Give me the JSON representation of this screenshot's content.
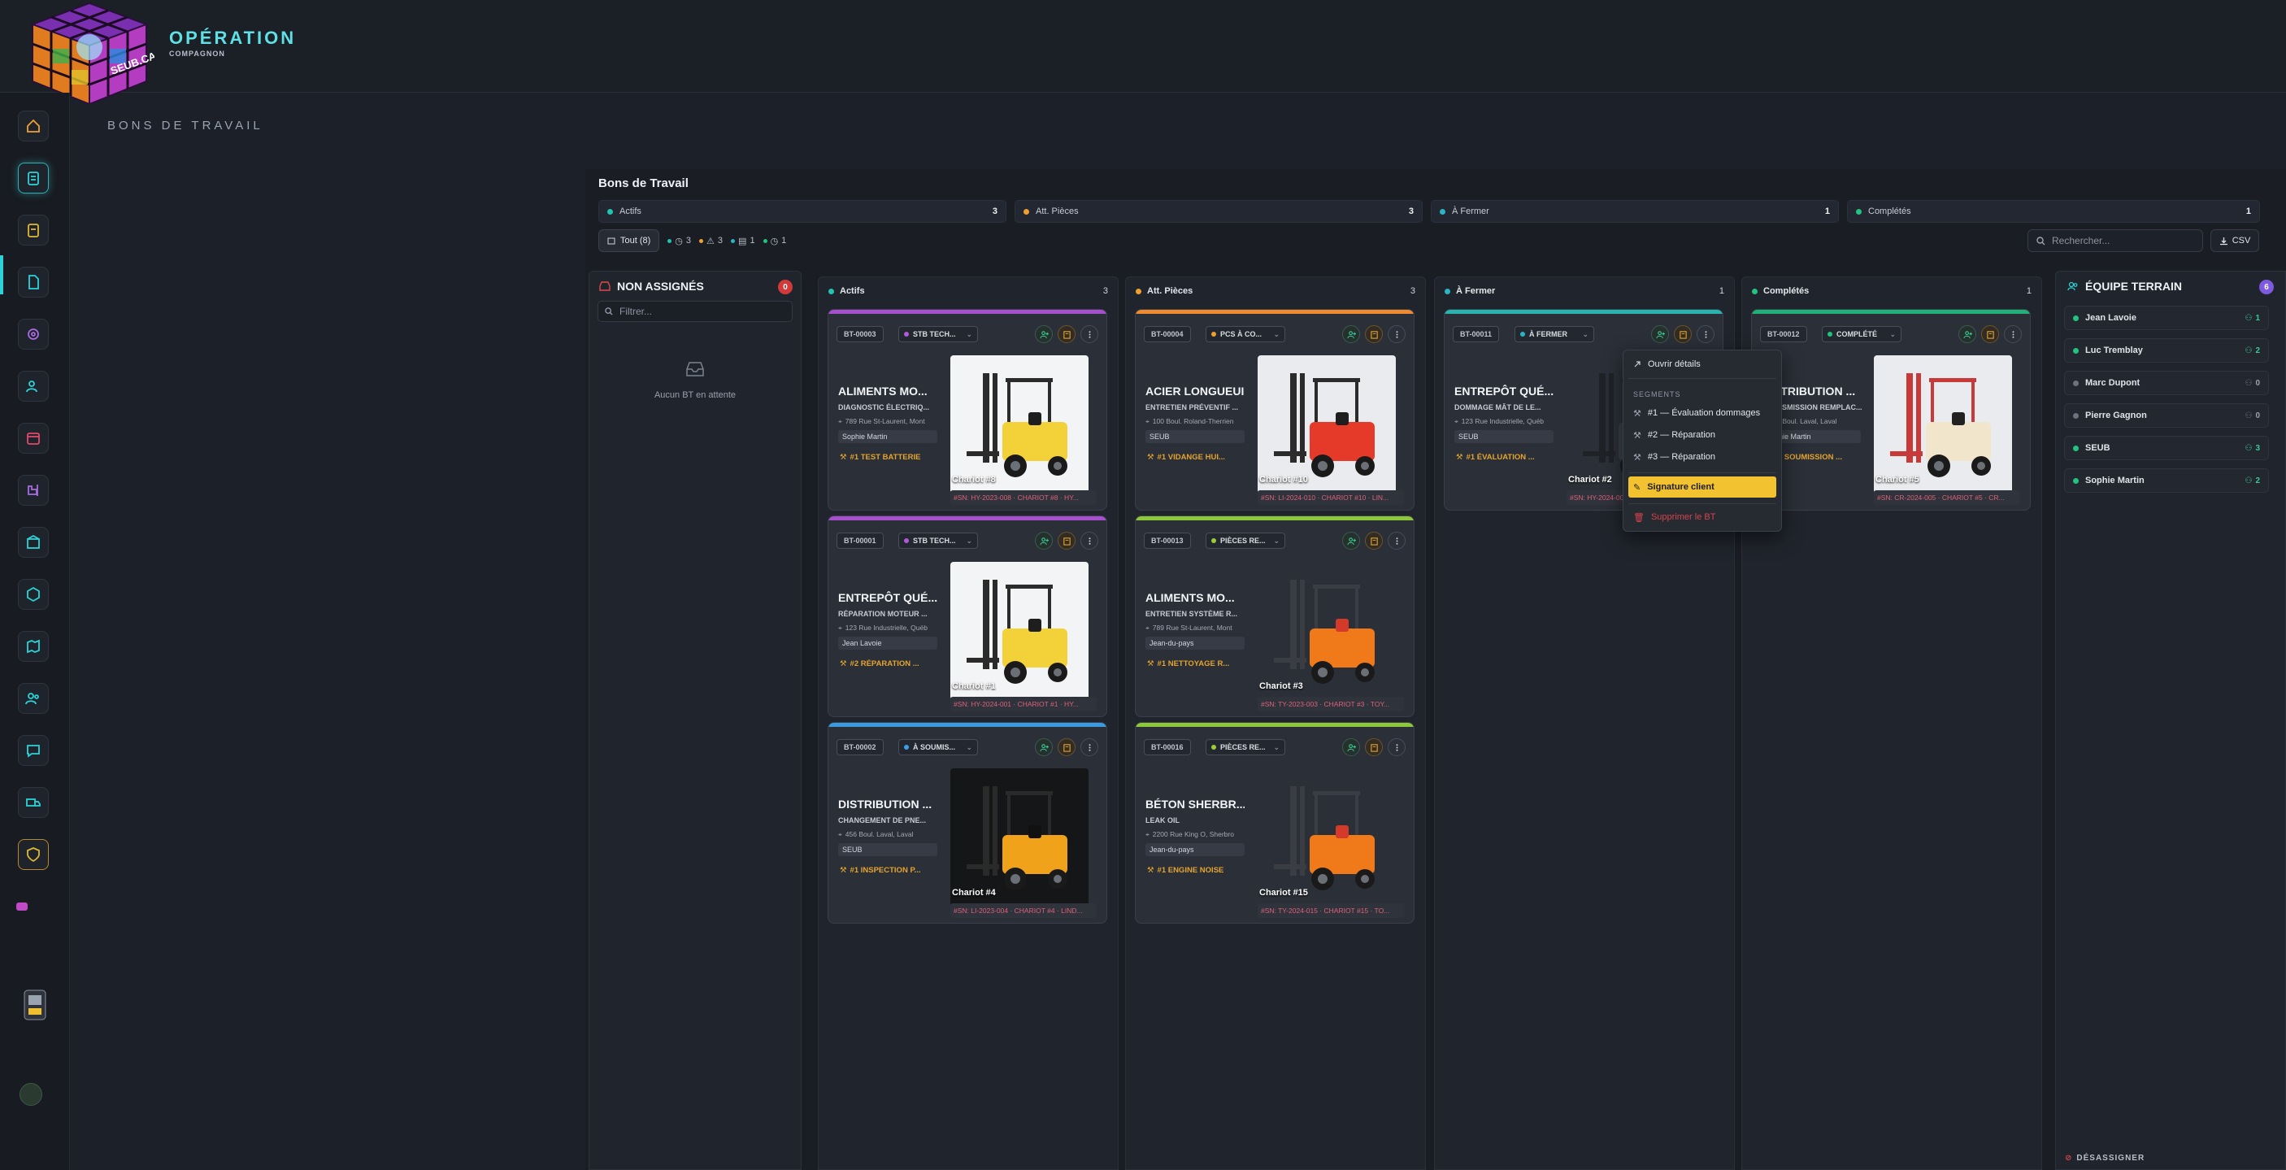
{
  "app": {
    "brand_title": "OPÉRATION",
    "brand_sub": "COMPAGNON",
    "logo_text": "SEUB.CA",
    "page_title": "BONS DE TRAVAIL"
  },
  "board": {
    "title": "Bons de Travail",
    "stats": [
      {
        "label": "Actifs",
        "count": "3",
        "color": "#22c3b0"
      },
      {
        "label": "Att. Pièces",
        "count": "3",
        "color": "#f0a030"
      },
      {
        "label": "À Fermer",
        "count": "1",
        "color": "#2ab4c4"
      },
      {
        "label": "Complétés",
        "count": "1",
        "color": "#22c380"
      }
    ],
    "filters": {
      "all_label": "Tout (8)",
      "chips": [
        "3",
        "3",
        "1",
        "1"
      ]
    },
    "search_placeholder": "Rechercher...",
    "csv_label": "CSV"
  },
  "unassigned": {
    "title": "NON ASSIGNÉS",
    "count": "0",
    "filter_placeholder": "Filtrer...",
    "empty_text": "Aucun BT en attente"
  },
  "columns": [
    {
      "title": "Actifs",
      "count": "3",
      "color": "#22c3b0"
    },
    {
      "title": "Att. Pièces",
      "count": "3",
      "color": "#f0a030"
    },
    {
      "title": "À Fermer",
      "count": "1",
      "color": "#2ab4c4"
    },
    {
      "title": "Complétés",
      "count": "1",
      "color": "#22c380"
    }
  ],
  "cards": [
    {
      "bt": "BT-00003",
      "status": "STB TECH...",
      "status_color": "#b05bd6",
      "top": "#a84fd0",
      "client": "ALIMENTS MO...",
      "job": "DIAGNOSTIC ÉLECTRIQ...",
      "address": "789 Rue St-Laurent, Mont",
      "tech": "Sophie Martin",
      "segment": "#1 TEST BATTERIE",
      "chariot": "Chariot #8",
      "sn": "#SN: HY-2023-008 · CHARIOT #8 · HY...",
      "photo": "yellow"
    },
    {
      "bt": "BT-00001",
      "status": "STB TECH...",
      "status_color": "#b05bd6",
      "top": "#a84fd0",
      "client": "ENTREPÔT QUÉ...",
      "job": "RÉPARATION MOTEUR ...",
      "address": "123 Rue Industrielle, Québ",
      "tech": "Jean Lavoie",
      "segment": "#2 RÉPARATION ...",
      "chariot": "Chariot #1",
      "sn": "#SN: HY-2024-001 · CHARIOT #1 · HY...",
      "photo": "yellow"
    },
    {
      "bt": "BT-00002",
      "status": "À SOUMIS...",
      "status_color": "#3aa0e0",
      "top": "#3a9be0",
      "client": "DISTRIBUTION ...",
      "job": "CHANGEMENT DE PNE...",
      "address": "456 Boul. Laval, Laval",
      "tech": "SEUB",
      "segment": "#1 INSPECTION P...",
      "chariot": "Chariot #4",
      "sn": "#SN: LI-2023-004 · CHARIOT #4 · LIND...",
      "photo": "darkyellow"
    },
    {
      "bt": "BT-00004",
      "status": "PCS À CO...",
      "status_color": "#f0a030",
      "top": "#f08a30",
      "client": "ACIER LONGUEUIL",
      "job": "ENTRETIEN PRÉVENTIF ...",
      "address": "100 Boul. Roland-Therrien",
      "tech": "SEUB",
      "segment": "#1 VIDANGE HUI...",
      "chariot": "Chariot #10",
      "sn": "#SN: LI-2024-010 · CHARIOT #10 · LIN...",
      "photo": "red"
    },
    {
      "bt": "BT-00013",
      "status": "PIÈCES RE...",
      "status_color": "#9ccc3a",
      "top": "#8cc83a",
      "client": "ALIMENTS MO...",
      "job": "ENTRETIEN SYSTÈME R...",
      "address": "789 Rue St-Laurent, Mont",
      "tech": "Jean-du-pays",
      "segment": "#1 NETTOYAGE R...",
      "chariot": "Chariot #3",
      "sn": "#SN: TY-2023-003 · CHARIOT #3 · TOY...",
      "photo": "orange"
    },
    {
      "bt": "BT-00016",
      "status": "PIÈCES RE...",
      "status_color": "#9ccc3a",
      "top": "#8cc83a",
      "client": "BÉTON SHERBR...",
      "job": "LEAK OIL",
      "address": "2200 Rue King O, Sherbro",
      "tech": "Jean-du-pays",
      "segment": "#1 ENGINE NOISE",
      "chariot": "Chariot #15",
      "sn": "#SN: TY-2024-015 · CHARIOT #15 · TO...",
      "photo": "orange"
    },
    {
      "bt": "BT-00011",
      "status": "À FERMER",
      "status_color": "#2ab4c4",
      "top": "#2ab4b0",
      "client": "ENTREPÔT QUÉ...",
      "job": "DOMMAGE MÂT DE LE...",
      "address": "123 Rue Industrielle, Québ",
      "tech": "SEUB",
      "segment": "#1 ÉVALUATION ...",
      "chariot": "Chariot #2",
      "sn": "#SN: HY-2024-002",
      "photo": "dark"
    },
    {
      "bt": "BT-00012",
      "status": "COMPLÉTÉ",
      "status_color": "#22c380",
      "top": "#22b07a",
      "client": "DISTRIBUTION ...",
      "job": "TRANSMISSION REMPLAC...",
      "address": "456 Boul. Laval, Laval",
      "tech": "Sophie Martin",
      "segment": "#1 SOUMISSION ...",
      "chariot": "Chariot #5",
      "sn": "#SN: CR-2024-005 · CHARIOT #5 · CR...",
      "photo": "cream"
    }
  ],
  "context_menu": {
    "open_details": "Ouvrir détails",
    "segments_label": "SEGMENTS",
    "segments": [
      "#1 — Évaluation dommages",
      "#2 — Réparation",
      "#3 — Réparation"
    ],
    "signature": "Signature client",
    "delete": "Supprimer le BT"
  },
  "team": {
    "title": "ÉQUIPE TERRAIN",
    "count": "6",
    "members": [
      {
        "name": "Jean Lavoie",
        "count": "1",
        "color": "#22c380"
      },
      {
        "name": "Luc Tremblay",
        "count": "2",
        "color": "#22c380"
      },
      {
        "name": "Marc Dupont",
        "count": "0",
        "color": "#6b7280"
      },
      {
        "name": "Pierre Gagnon",
        "count": "0",
        "color": "#6b7280"
      },
      {
        "name": "SEUB",
        "count": "3",
        "color": "#22c380"
      },
      {
        "name": "Sophie Martin",
        "count": "2",
        "color": "#22c380"
      }
    ],
    "unassign_label": "DÉSASSIGNER"
  }
}
